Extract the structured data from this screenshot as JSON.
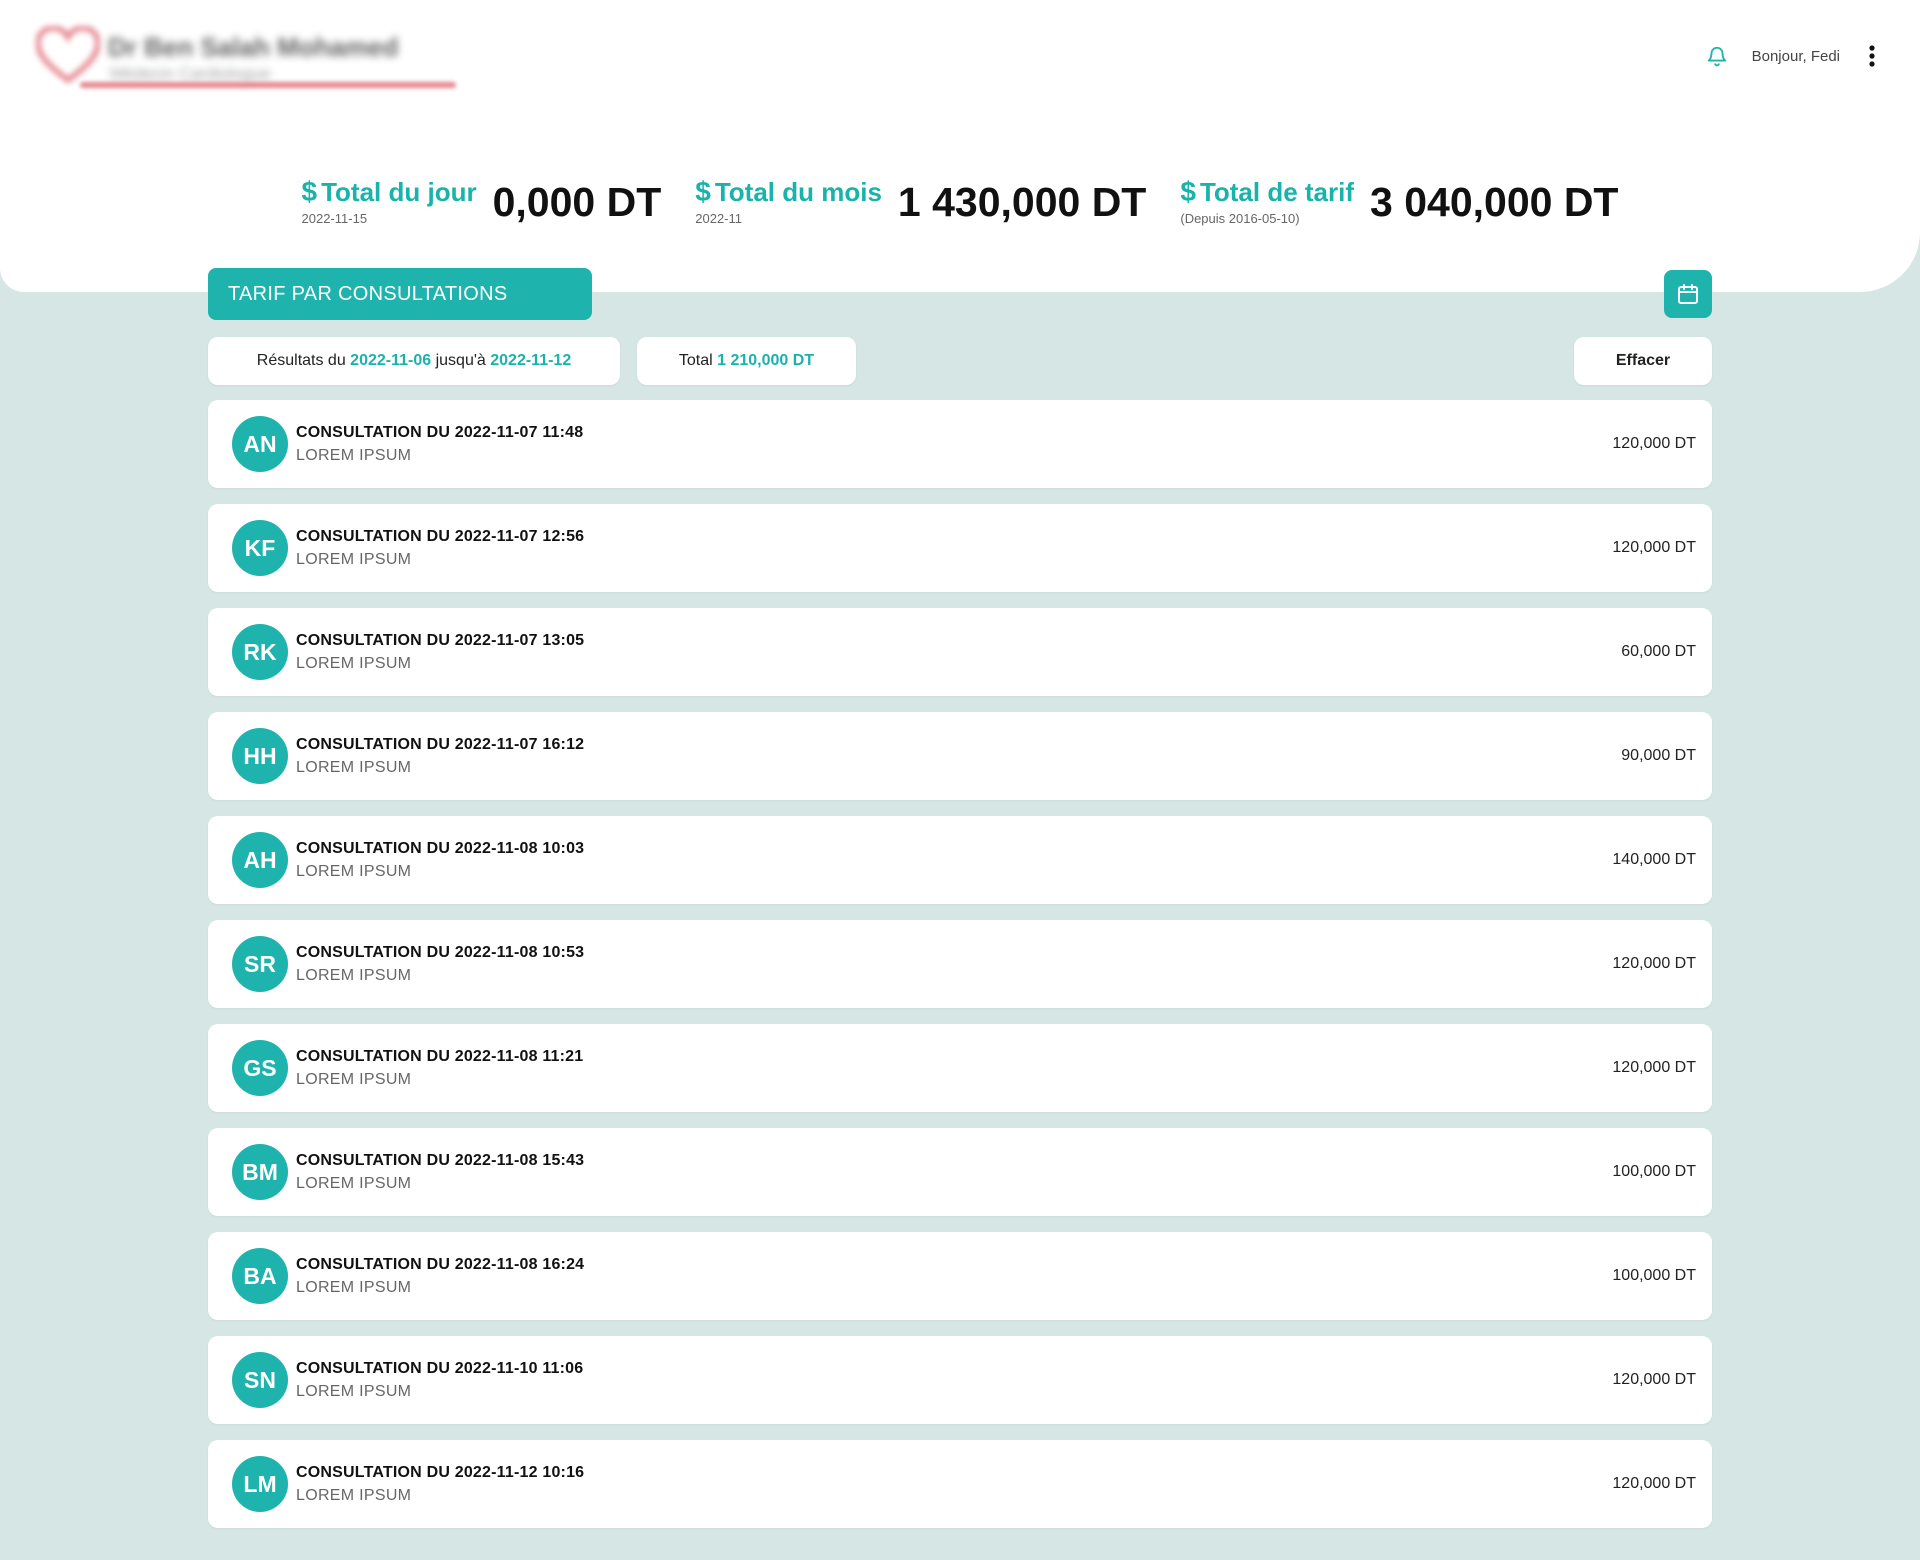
{
  "header": {
    "doctor_name": "Dr Ben Salah Mohamed",
    "specialty": "Médecin Cardiologue",
    "greeting": "Bonjour, Fedi"
  },
  "stats": {
    "symbol": "$",
    "day": {
      "label": "Total du jour",
      "sub": "2022-11-15",
      "value": "0,000 DT"
    },
    "month": {
      "label": "Total du mois",
      "sub": "2022-11",
      "value": "1 430,000 DT"
    },
    "tariff": {
      "label": "Total de tarif",
      "sub": "(Depuis 2016-05-10)",
      "value": "3 040,000 DT"
    }
  },
  "section": {
    "title": "TARIF PAR CONSULTATIONS"
  },
  "filters": {
    "results_prefix": "Résultats du",
    "from": "2022-11-06",
    "to_word": "jusqu'à",
    "to": "2022-11-12",
    "total_label": "Total",
    "total_value": "1 210,000 DT",
    "clear_label": "Effacer"
  },
  "consultations": [
    {
      "initials": "AN",
      "title": "CONSULTATION DU 2022-11-07 11:48",
      "subtitle": "LOREM IPSUM",
      "amount": "120,000 DT"
    },
    {
      "initials": "KF",
      "title": "CONSULTATION DU 2022-11-07 12:56",
      "subtitle": "LOREM IPSUM",
      "amount": "120,000 DT"
    },
    {
      "initials": "RK",
      "title": "CONSULTATION DU 2022-11-07 13:05",
      "subtitle": "LOREM IPSUM",
      "amount": "60,000 DT"
    },
    {
      "initials": "HH",
      "title": "CONSULTATION DU 2022-11-07 16:12",
      "subtitle": "LOREM IPSUM",
      "amount": "90,000 DT"
    },
    {
      "initials": "AH",
      "title": "CONSULTATION DU 2022-11-08 10:03",
      "subtitle": "LOREM IPSUM",
      "amount": "140,000 DT"
    },
    {
      "initials": "SR",
      "title": "CONSULTATION DU 2022-11-08 10:53",
      "subtitle": "LOREM IPSUM",
      "amount": "120,000 DT"
    },
    {
      "initials": "GS",
      "title": "CONSULTATION DU 2022-11-08 11:21",
      "subtitle": "LOREM IPSUM",
      "amount": "120,000 DT"
    },
    {
      "initials": "BM",
      "title": "CONSULTATION DU 2022-11-08 15:43",
      "subtitle": "LOREM IPSUM",
      "amount": "100,000 DT"
    },
    {
      "initials": "BA",
      "title": "CONSULTATION DU 2022-11-08 16:24",
      "subtitle": "LOREM IPSUM",
      "amount": "100,000 DT"
    },
    {
      "initials": "SN",
      "title": "CONSULTATION DU 2022-11-10 11:06",
      "subtitle": "LOREM IPSUM",
      "amount": "120,000 DT"
    },
    {
      "initials": "LM",
      "title": "CONSULTATION DU 2022-11-12 10:16",
      "subtitle": "LOREM IPSUM",
      "amount": "120,000 DT"
    }
  ],
  "icons": {
    "bell": "bell-icon",
    "menu": "kebab-menu-icon",
    "calendar": "calendar-icon",
    "logo": "heart-logo-icon"
  },
  "colors": {
    "accent": "#1fb3ad",
    "background": "#d6e6e5",
    "brand": "#e0707a"
  }
}
